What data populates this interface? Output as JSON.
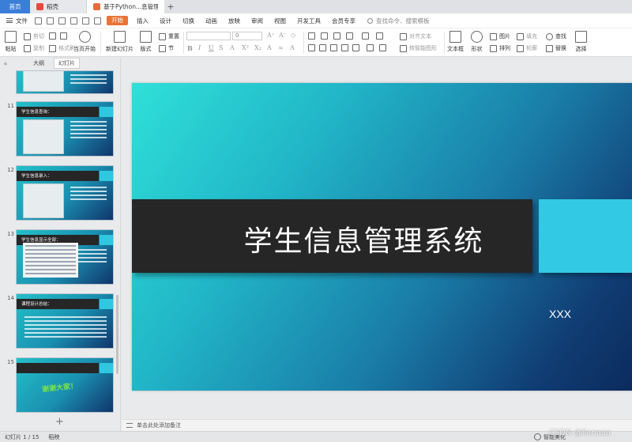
{
  "tabs": {
    "home": "首页",
    "doc": "稻壳",
    "active": "基于Python...息管理系统 管",
    "plus": "+"
  },
  "menu": {
    "file": "文件",
    "items": [
      "开始",
      "插入",
      "设计",
      "切换",
      "动画",
      "放映",
      "审阅",
      "视图",
      "开发工具",
      "会员专享"
    ],
    "search": "查找命令、搜索模板"
  },
  "ribbon": {
    "paste": "粘贴",
    "cut": "剪切",
    "copy": "复制",
    "format_painter": "格式刷",
    "from_start": "当页开始",
    "new_slide": "新建幻灯片",
    "layout": "版式",
    "section": "节",
    "reset": "重置",
    "font_size": "0",
    "align_text": "对齐文本",
    "smartart": "转智能图形",
    "textbox": "文本框",
    "shape": "形状",
    "picture": "图片",
    "arrange": "排列",
    "fill": "填充",
    "outline": "轮廓",
    "find": "查找",
    "replace": "替换",
    "select": "选择"
  },
  "panel": {
    "outline_tab": "大纲",
    "slides_tab": "幻灯片",
    "add": "+",
    "thumbs": [
      {
        "num": "11",
        "title": "学生信息查询："
      },
      {
        "num": "12",
        "title": "学生信息录入："
      },
      {
        "num": "13",
        "title": "学生信息显示全部："
      },
      {
        "num": "14",
        "title": "课程设计总结："
      },
      {
        "num": "15",
        "title": "",
        "thanks": "谢谢大家！"
      }
    ]
  },
  "slide": {
    "title": "学生信息管理系统",
    "subtitle": "XXX"
  },
  "notes": "单击此处添加备注",
  "status": {
    "slide_counter": "幻灯片 1 / 15",
    "theme": "稻秧",
    "smart_beautify": "智能美化"
  },
  "watermark": "CSDN @lianaaa",
  "colors": {
    "accent": "#e97335",
    "home_tab": "#3b7ed8",
    "title_bar": "#262626",
    "square": "#31c9e3"
  }
}
